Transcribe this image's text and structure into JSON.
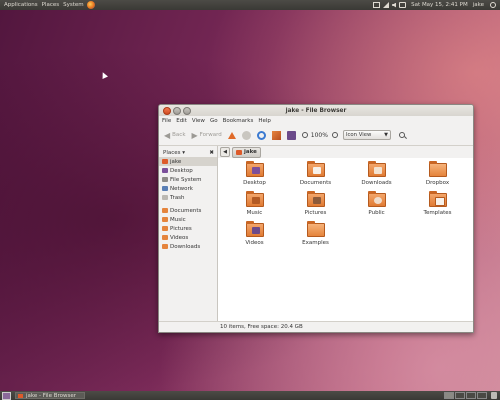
{
  "top_panel": {
    "menus": [
      "Applications",
      "Places",
      "System"
    ],
    "clock": "Sat May 15,  2:41 PM",
    "user": "jake"
  },
  "window": {
    "title": "jake - File Browser",
    "menubar": [
      "File",
      "Edit",
      "View",
      "Go",
      "Bookmarks",
      "Help"
    ],
    "toolbar": {
      "back_label": "Back",
      "forward_label": "Forward",
      "zoom": "100%",
      "view_mode": "Icon View"
    },
    "sidebar": {
      "header": "Places",
      "places": [
        "jake",
        "Desktop",
        "File System",
        "Network",
        "Trash"
      ],
      "bookmarks": [
        "Documents",
        "Music",
        "Pictures",
        "Videos",
        "Downloads"
      ]
    },
    "pathbar": {
      "crumb": "jake"
    },
    "items": [
      {
        "name": "Desktop",
        "icon": "desktop-folder-icon"
      },
      {
        "name": "Documents",
        "icon": "documents-folder-icon"
      },
      {
        "name": "Downloads",
        "icon": "downloads-folder-icon"
      },
      {
        "name": "Dropbox",
        "icon": "folder-icon"
      },
      {
        "name": "Music",
        "icon": "music-folder-icon"
      },
      {
        "name": "Pictures",
        "icon": "pictures-folder-icon"
      },
      {
        "name": "Public",
        "icon": "public-folder-icon"
      },
      {
        "name": "Templates",
        "icon": "templates-folder-icon"
      },
      {
        "name": "Videos",
        "icon": "videos-folder-icon"
      },
      {
        "name": "Examples",
        "icon": "folder-icon"
      }
    ],
    "status": "10 items, Free space: 20.4 GB"
  },
  "bottom_panel": {
    "task": "jake - File Browser"
  }
}
